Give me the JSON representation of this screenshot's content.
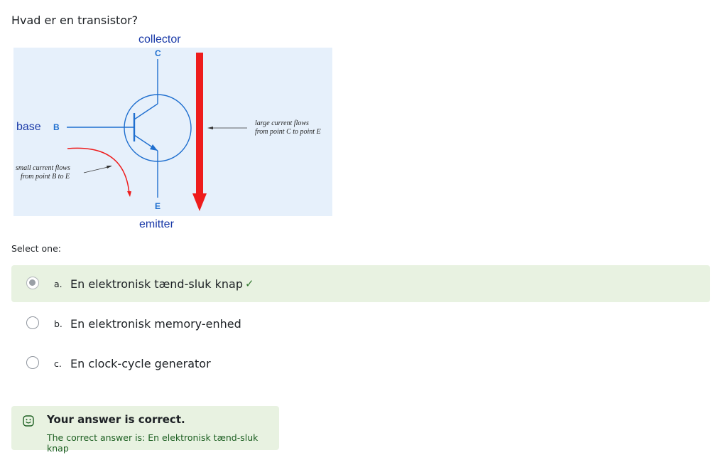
{
  "question": {
    "text": "Hvad er en transistor?"
  },
  "diagram": {
    "label_collector": "collector",
    "label_c": "C",
    "label_base": "base",
    "label_b": "B",
    "label_emitter": "emitter",
    "label_e": "E",
    "note_large_line1": "large current flows",
    "note_large_line2": "from point C to point E",
    "note_small_line1": "small current flows",
    "note_small_line2": "from point B to E"
  },
  "prompt": "Select one:",
  "options": [
    {
      "letter": "a.",
      "text": "En elektronisk tænd-sluk knap",
      "selected": true,
      "correct": true
    },
    {
      "letter": "b.",
      "text": "En elektronisk memory-enhed",
      "selected": false,
      "correct": false
    },
    {
      "letter": "c.",
      "text": "En clock-cycle generator",
      "selected": false,
      "correct": false
    }
  ],
  "check_mark": "✓",
  "feedback": {
    "title": "Your answer is correct.",
    "answer": "The correct answer is: En elektronisk tænd-sluk knap"
  },
  "colors": {
    "correct_bg": "#e8f2e1",
    "diagram_bg": "#e6f0fb",
    "diagram_blue": "#1f6fcf",
    "arrow_red": "#ee1c1c",
    "check_green": "#357a32"
  }
}
